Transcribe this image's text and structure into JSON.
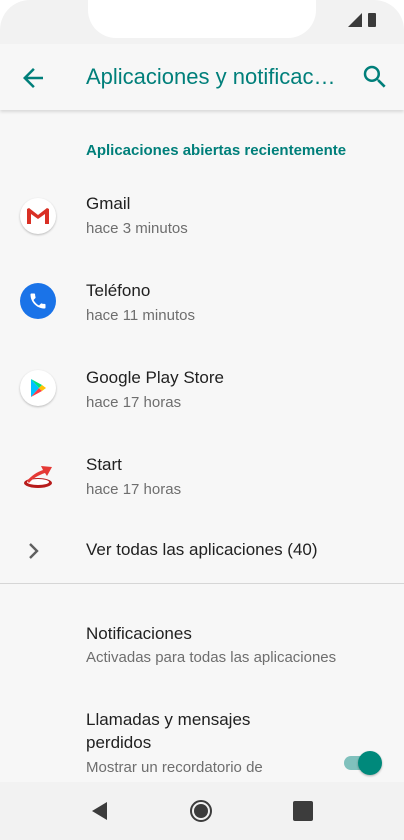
{
  "appbar": {
    "title": "Aplicaciones y notificaciones"
  },
  "section": {
    "recent_header": "Aplicaciones abiertas recientemente"
  },
  "recent_apps": [
    {
      "name": "Gmail",
      "time": "hace 3 minutos",
      "icon": "gmail-icon"
    },
    {
      "name": "Teléfono",
      "time": "hace 11 minutos",
      "icon": "phone-icon"
    },
    {
      "name": "Google Play Store",
      "time": "hace 17 horas",
      "icon": "play-store-icon"
    },
    {
      "name": "Start",
      "time": "hace 17 horas",
      "icon": "start-icon"
    }
  ],
  "see_all": {
    "label": "Ver todas las aplicaciones (40)"
  },
  "settings": [
    {
      "title": "Notificaciones",
      "subtitle": "Activadas para todas las aplicaciones"
    },
    {
      "title": "Llamadas y mensajes perdidos",
      "subtitle": "Mostrar un recordatorio de",
      "toggle_on": true
    }
  ],
  "colors": {
    "accent": "#007f7a",
    "toggle_thumb": "#00897b",
    "toggle_track": "#80c1bd"
  }
}
